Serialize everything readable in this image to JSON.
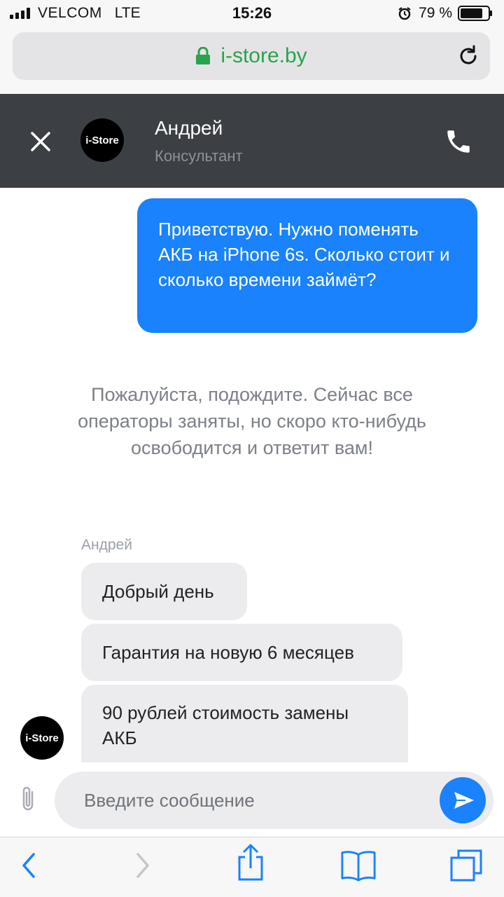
{
  "status_bar": {
    "carrier": "VELCOM",
    "network": "LTE",
    "time": "15:26",
    "battery": "79 %"
  },
  "url_bar": {
    "domain": "i-store.by"
  },
  "chat_header": {
    "logo_text": "i-Store",
    "agent_name": "Андрей",
    "agent_role": "Консультант"
  },
  "messages": {
    "outgoing": "Приветствую. Нужно поменять АКБ на iPhone 6s. Сколько стоит и сколько времени займёт?",
    "system": "Пожалуйста, подождите. Сейчас все операторы заняты, но скоро кто-нибудь освободится и ответит вам!",
    "sender": "Андрей",
    "incoming": [
      "Добрый день",
      "Гарантия на новую 6 месяцев",
      "90 рублей стоимость замены АКБ"
    ],
    "avatar_text": "i-Store"
  },
  "composer": {
    "placeholder": "Введите сообщение"
  },
  "colors": {
    "accent": "#1982fc",
    "header_bg": "#3c3f44",
    "secure_green": "#2aa34a"
  },
  "icons": [
    "signal-icon",
    "alarm-icon",
    "battery-icon",
    "lock-icon",
    "reload-icon",
    "close-icon",
    "phone-icon",
    "attach-icon",
    "send-icon",
    "back-icon",
    "forward-icon",
    "share-icon",
    "bookmarks-icon",
    "tabs-icon"
  ]
}
